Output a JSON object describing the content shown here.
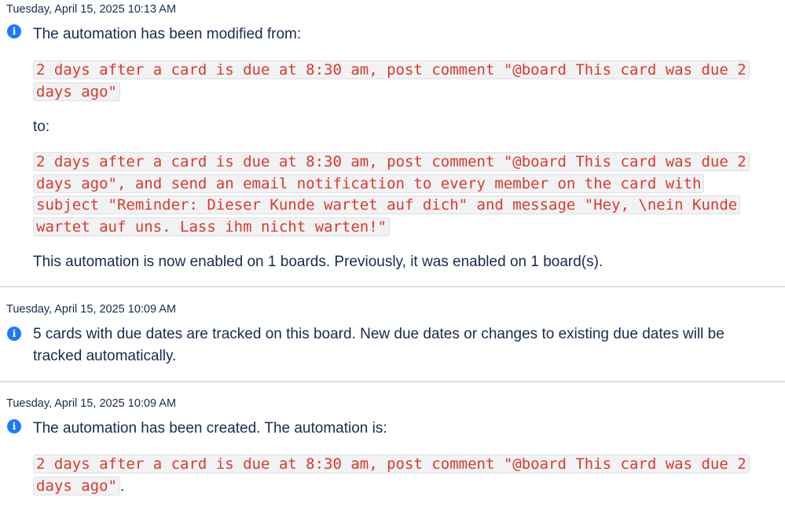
{
  "entries": [
    {
      "timestamp": "Tuesday, April 15, 2025 10:13 AM",
      "icon": "info-icon",
      "message": "The automation has been modified from:",
      "old_rule": "2 days after a card is due at 8:30 am, post comment \"@board This card was due 2 days ago\"",
      "connector": "to:",
      "new_rule": "2 days after a card is due at 8:30 am, post comment \"@board This card was due 2 days ago\", and send an email notification to every member on the card with subject \"Reminder: Dieser Kunde wartet auf dich\" and message \"Hey, \\nein Kunde wartet auf uns. Lass ihm nicht warten!\"",
      "footer": "This automation is now enabled on 1 boards. Previously, it was enabled on 1 board(s)."
    },
    {
      "timestamp": "Tuesday, April 15, 2025 10:09 AM",
      "icon": "info-icon",
      "message": "5 cards with due dates are tracked on this board. New due dates or changes to existing due dates will be tracked automatically."
    },
    {
      "timestamp": "Tuesday, April 15, 2025 10:09 AM",
      "icon": "info-icon",
      "message": "The automation has been created. The automation is:",
      "rule": "2 days after a card is due at 8:30 am, post comment \"@board This card was due 2 days ago\"",
      "rule_suffix": "."
    }
  ],
  "colors": {
    "info_icon": "#1d7afc",
    "code_text": "#d93a2a",
    "code_background": "#f1f2f4",
    "separator": "#dcdfe4"
  }
}
